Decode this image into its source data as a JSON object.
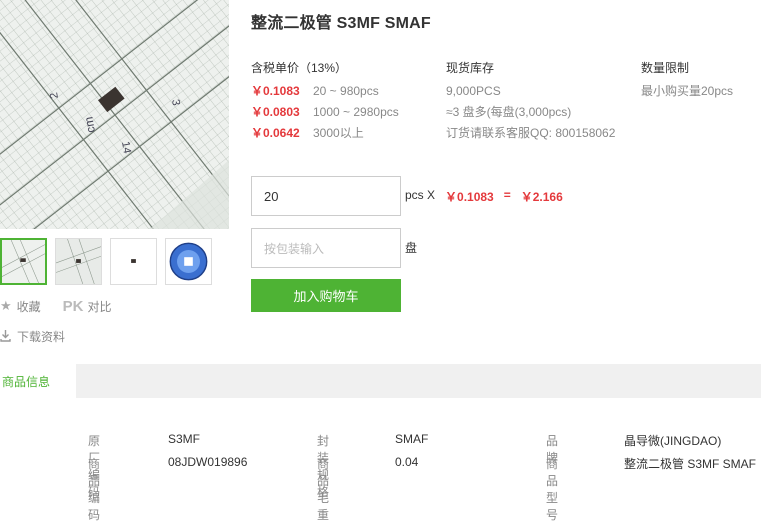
{
  "product": {
    "title": "整流二极管 S3MF SMAF"
  },
  "pricing": {
    "header": "含税单价（13%）",
    "tiers": [
      {
        "price": "￥0.1083",
        "range": "20 ~ 980pcs"
      },
      {
        "price": "￥0.0803",
        "range": "1000 ~ 2980pcs"
      },
      {
        "price": "￥0.0642",
        "range": "3000以上"
      }
    ]
  },
  "stock": {
    "header": "现货库存",
    "amount": "9,000PCS",
    "reels": "≈3 盘多(每盘(3,000pcs)",
    "contact": "订货请联系客服QQ: 800158062"
  },
  "limit": {
    "header": "数量限制",
    "min": "最小购买量20pcs"
  },
  "order": {
    "quantity": "20",
    "unit_x": "pcs X",
    "unit_price": "￥0.1083",
    "equals": "=",
    "total": "￥2.166",
    "pack_placeholder": "按包装输入",
    "pack_unit": "盘",
    "add_cart": "加入购物车"
  },
  "side": {
    "favorite": "收藏",
    "pk": "PK",
    "compare": "对比",
    "download": "下载资料"
  },
  "tabs": {
    "info": "商品信息"
  },
  "info": {
    "rows": [
      [
        {
          "label": "原厂编码",
          "value": "S3MF"
        },
        {
          "label": "封装规格",
          "value": "SMAF"
        },
        {
          "label": "品牌",
          "value": "晶导微(JINGDAO)"
        }
      ],
      [
        {
          "label": "商品编码",
          "value": "08JDW019896"
        },
        {
          "label": "商品毛重",
          "value": "0.04"
        },
        {
          "label": "商品型号",
          "value": "整流二极管 S3MF SMAF"
        }
      ]
    ]
  },
  "colors": {
    "accent_green": "#4eb334",
    "price_red": "#e4393c"
  },
  "icons": {
    "favorite": "star-icon",
    "download": "download-icon"
  }
}
